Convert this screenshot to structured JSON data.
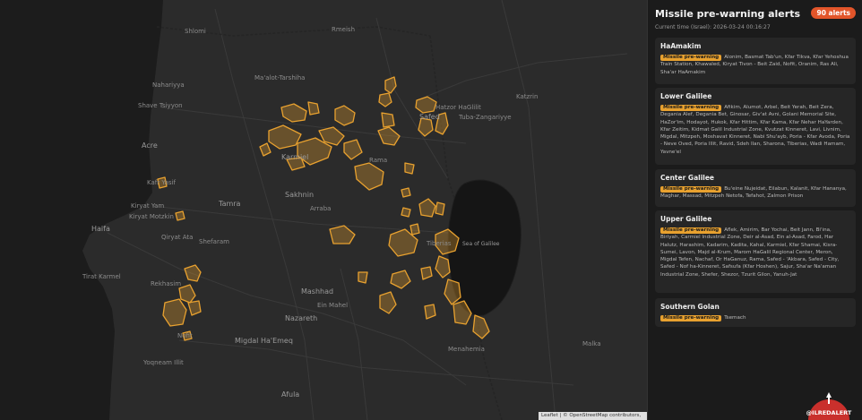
{
  "map": {
    "place_labels": {
      "shlomi": "Shlomi",
      "rmeish": "Rmeish",
      "nahariyya": "Nahariyya",
      "maalot": "Ma'alot-Tarshiha",
      "shave_tsiyyon": "Shave Tsiyyon",
      "hatzor": "Hatzor HaGlilit",
      "katzrin": "Katzrin",
      "tuba": "Tuba-Zangariyye",
      "karmiel": "Karmiel",
      "safed": "Safed",
      "acre": "Acre",
      "kafr_yasif": "Kafr Yasif",
      "rama": "Rama",
      "sakhnin": "Sakhnin",
      "tamra": "Tamra",
      "arraba": "Arraba",
      "kiryat_yam": "Kiryat Yam",
      "kiryat_motzkin": "Kiryat Motzkin",
      "haifa": "Haifa",
      "qiryat_ata": "Qiryat Ata",
      "shefaram": "Shefaram",
      "tiberias": "Tiberias",
      "sea_of_galilee": "Sea of Galilee",
      "tirat_karmel": "Tirat Karmel",
      "rekhasim": "Rekhasim",
      "mashhad": "Mashhad",
      "ein_mahel": "Ein Mahel",
      "nazareth": "Nazareth",
      "migdal_haemeq": "Migdal Ha'Emeq",
      "yoqneam": "Yoqneam Illit",
      "afula": "Afula",
      "malka": "Malka",
      "nofit": "Nofit",
      "menahemia": "Menahemia"
    },
    "attribution": "Leaflet | © OpenStreetMap contributors, Jawg",
    "colors": {
      "land": "#2b2b2b",
      "sea": "#1c1c1c",
      "lake": "#151515",
      "alert_fill": "rgba(232,161,47,0.32)",
      "alert_stroke": "#e8a12f",
      "roads": "#3a3a3a"
    }
  },
  "logo": {
    "text": "@ILREDALERT",
    "color": "#c9302c"
  },
  "panel": {
    "title": "Missile pre-warning alerts",
    "count_badge": "90 alerts",
    "current_time": "Current time (Israel): 2026-03-24 00:16:27",
    "badge_label": "Missile pre-warning",
    "regions": [
      {
        "name": "HaAmakim",
        "places": "Alonim, Basmat Tab'un, Kfar Tikva, Kfar Yehoshua Train Station, Khawaled, Kiryat Tivon - Beit Zaid, Nofit, Oranim, Ras Ali, Sha'ar HaAmakim"
      },
      {
        "name": "Lower Galilee",
        "places": "Afikim, Alumot, Arbel, Beit Yerah, Beit Zera, Degania Alef, Degania Bet, Ginosar, Giv'at Avni, Golani Memorial Site, HaZor'im, Hodayot, Hukok, Kfar Hittim, Kfar Kama, Kfar Nehar HaYarden, Kfar Zeitim, Kidmat Galil Industrial Zone, Kvutzat Kinneret, Lavi, Livnim, Migdal, Mitzpeh, Moshavat Kinneret, Nabi Shu'ayb, Poria - Kfar Avoda, Poria - Neve Oved, Poria Illit, Ravid, Sdeh Ilan, Sharona, Tiberias, Wadi Hamam, Yavne'el"
      },
      {
        "name": "Center Galilee",
        "places": "Bu'eine Nujeidat, Eilabun, Kalanit, Kfar Hananya, Maghar, Massad, Mitzpeh Netofa, Tefahot, Zalmon Prison"
      },
      {
        "name": "Upper Galilee",
        "places": "Aflek, Amirim, Bar Yochai, Beit Jann, Bi'ina, Biriyah, Carmiel Industrial Zone, Deir al-Asad, Ein al-Asad, Farod, Har Halutz, Harashim, Kadarim, Kadita, Kahal, Karmiel, Kfar Shamai, Kisra-Sumei, Lavon, Majd al-Krum, Marom HaGalil Regional Center, Meron, Migdal Tefen, Nachaf, Or HaGanuz, Rama, Safed - 'Akbara, Safed - City, Safed - Nof ha-Kinneret, Safsufa (Kfar Hoshen), Sajur, Sha'ar Na'aman Industrial Zone, Shefer, Shezor, Tzurit Gilon, Yanuh-Jat"
      },
      {
        "name": "Southern Golan",
        "places": "Tsemach"
      }
    ]
  }
}
